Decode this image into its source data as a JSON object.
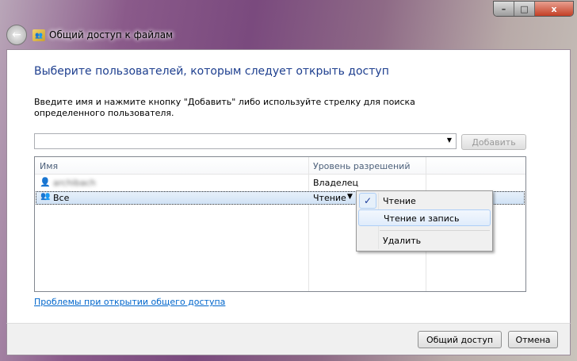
{
  "window": {
    "title": "Общий доступ к файлам",
    "minimize": "–",
    "maximize": "□",
    "close": "x"
  },
  "heading": "Выберите пользователей, которым следует открыть доступ",
  "instruction": "Введите имя и нажмите кнопку \"Добавить\" либо используйте стрелку для поиска определенного пользователя.",
  "input": {
    "value": "",
    "placeholder": ""
  },
  "add_button": "Добавить",
  "table": {
    "columns": [
      "Имя",
      "Уровень разрешений"
    ],
    "rows": [
      {
        "name": "archibach",
        "permission": "Владелец"
      },
      {
        "name": "Все",
        "permission": "Чтение"
      }
    ]
  },
  "menu": {
    "items": [
      "Чтение",
      "Чтение и запись",
      "Удалить"
    ],
    "checked": "Чтение",
    "highlighted": "Чтение и запись"
  },
  "help_link": "Проблемы при открытии общего доступа",
  "share_button": "Общий доступ",
  "cancel_button": "Отмена"
}
